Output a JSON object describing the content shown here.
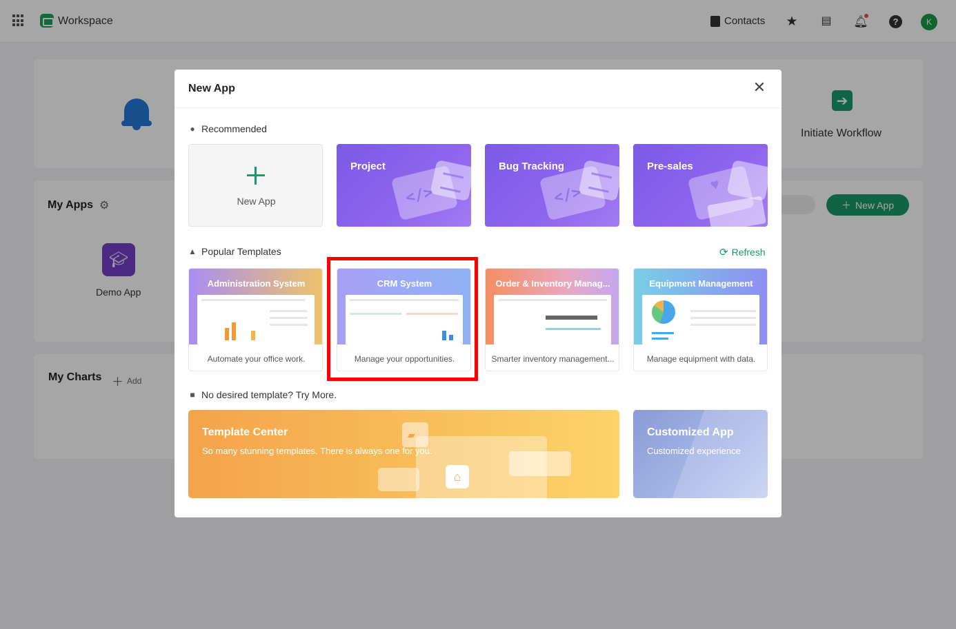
{
  "topbar": {
    "app_title": "Workspace",
    "contacts_label": "Contacts",
    "avatar_initial": "K"
  },
  "background": {
    "initiate_workflow_label": "Initiate Workflow",
    "my_apps_title": "My Apps",
    "new_app_button": "New App",
    "demo_app_label": "Demo App",
    "my_charts_title": "My Charts",
    "add_label": "Add"
  },
  "modal": {
    "title": "New App",
    "recommended_label": "Recommended",
    "recommended": [
      {
        "label": "New App"
      },
      {
        "label": "Project"
      },
      {
        "label": "Bug Tracking"
      },
      {
        "label": "Pre-sales"
      }
    ],
    "popular_label": "Popular Templates",
    "refresh_label": "Refresh",
    "templates": [
      {
        "title": "Administration System",
        "desc": "Automate your office work."
      },
      {
        "title": "CRM System",
        "desc": "Manage your opportunities."
      },
      {
        "title": "Order & Inventory Manag...",
        "desc": "Smarter inventory management..."
      },
      {
        "title": "Equipment Management",
        "desc": "Manage equipment with data."
      }
    ],
    "more_label": "No desired template? Try More.",
    "template_center": {
      "title": "Template Center",
      "subtitle": "So many stunning templates. There is always one for you."
    },
    "customized_app": {
      "title": "Customized App",
      "subtitle": "Customized experience"
    }
  },
  "colors": {
    "accent": "#1a9a6a",
    "highlight": "#ff0000",
    "purple": "#8f65ee"
  },
  "icons": [
    "apps-grid-icon",
    "workspace-logo-icon",
    "contacts-icon",
    "star-icon",
    "task-icon",
    "bell-icon",
    "help-icon",
    "close-icon",
    "plus-icon",
    "lightbulb-icon",
    "thumbs-up-icon",
    "refresh-icon",
    "cube-icon"
  ]
}
